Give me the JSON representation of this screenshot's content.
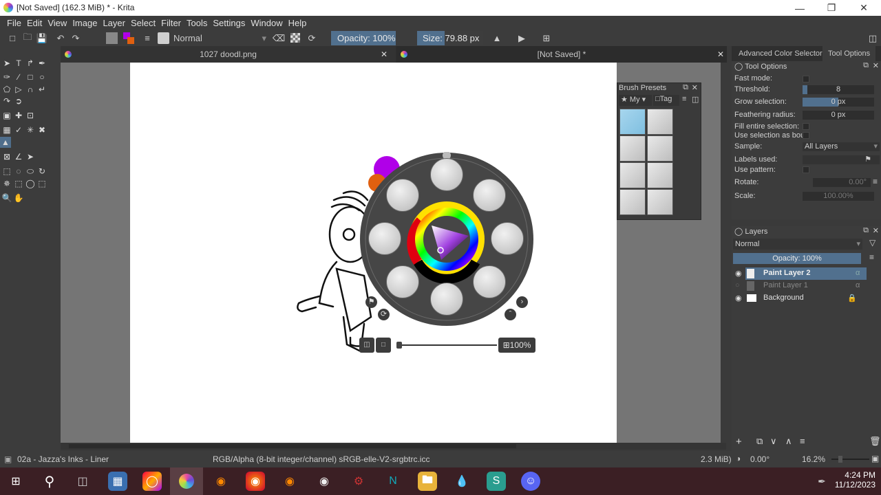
{
  "window": {
    "title": "[Not Saved]  (162.3 MiB)  * - Krita",
    "minimize_icon": "minimize-icon",
    "maximize_icon": "restore-icon",
    "close_icon": "close-icon"
  },
  "menu": [
    "File",
    "Edit",
    "View",
    "Image",
    "Layer",
    "Select",
    "Filter",
    "Tools",
    "Settings",
    "Window",
    "Help"
  ],
  "toolbar": {
    "blend_mode": "Normal",
    "opacity": "Opacity: 100%",
    "size": "Size: 79.88 px",
    "foreground_color": "#b000e8",
    "background_color": "#e06010"
  },
  "tabs": [
    {
      "label": "1027 doodl.png",
      "active": false
    },
    {
      "label": "[Not Saved]  *",
      "active": true
    }
  ],
  "tools": [
    [
      "select-shapes",
      "text",
      "edit-shapes",
      "calligraphy"
    ],
    [
      "freehand-brush",
      "line",
      "rectangle",
      "ellipse"
    ],
    [
      "polygon",
      "polyline",
      "bezier",
      "freehand-path"
    ],
    [
      "dynamic-brush",
      "multibrush"
    ],
    [
      "transform",
      "move",
      "crop"
    ],
    [
      "gradient",
      "color-picker",
      "smart-patch",
      "fill-reference"
    ],
    [
      "fill"
    ],
    [
      "assistant",
      "measure",
      "reference-pin"
    ],
    [
      "rect-select",
      "ellipse-select",
      "polygon-select",
      "freehand-select"
    ],
    [
      "contiguous-select",
      "similar-select",
      "bezier-select",
      "magnetic-select"
    ],
    [
      "zoom",
      "pan"
    ]
  ],
  "docker_tabs": [
    "Advanced Color Selector",
    "Tool Options"
  ],
  "tool_options": {
    "title": "Tool Options",
    "fast_mode": "Fast mode:",
    "threshold_label": "Threshold:",
    "threshold_value": "8",
    "grow_label": "Grow selection:",
    "grow_value": "0 px",
    "feather_label": "Feathering radius:",
    "feather_value": "0 px",
    "fill_entire": "Fill entire selection:",
    "use_selection": "Use selection as bou",
    "sample_label": "Sample:",
    "sample_value": "All Layers",
    "labels_label": "Labels used:",
    "pattern_label": "Use pattern:",
    "rotate_label": "Rotate:",
    "rotate_value": "0.00°",
    "scale_label": "Scale:",
    "scale_value": "100.00%"
  },
  "brush_presets": {
    "title": "Brush Presets",
    "filter": "My",
    "tag": "Tag"
  },
  "layers": {
    "title": "Layers",
    "blend_mode": "Normal",
    "opacity": "Opacity:  100%",
    "items": [
      {
        "name": "Paint Layer 2",
        "selected": true,
        "visible": true
      },
      {
        "name": "Paint Layer 1",
        "selected": false,
        "visible": false
      },
      {
        "name": "Background",
        "selected": false,
        "visible": true
      }
    ]
  },
  "popup_palette": {
    "zoom": "100%"
  },
  "status": {
    "brush": "02a - Jazza's Inks - Liner",
    "color_profile": "RGB/Alpha (8-bit integer/channel)  sRGB-elle-V2-srgbtrc.icc",
    "memory": "2.3 MiB)",
    "rotation": "0.00°",
    "zoom": "16.2%"
  },
  "taskbar": {
    "time": "4:24 PM",
    "date": "11/12/2023",
    "apps": [
      "start",
      "search",
      "task-view",
      "calculator",
      "creative-cloud",
      "krita",
      "blender",
      "firefox",
      "blender-2",
      "obs",
      "gpu-tweak",
      "app-n",
      "file-explorer",
      "paint-drop",
      "surfshark",
      "discord"
    ]
  }
}
